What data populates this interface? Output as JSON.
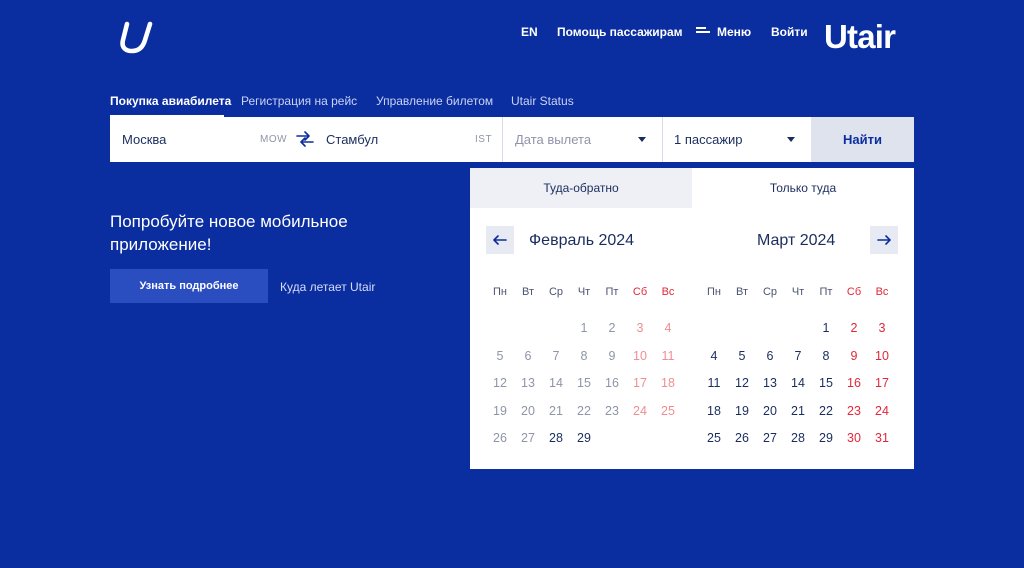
{
  "brand": "Utair",
  "topnav": {
    "lang": "EN",
    "help": "Помощь пассажирам",
    "menu": "Меню",
    "login": "Войти"
  },
  "tabs": [
    "Покупка авиабилета",
    "Регистрация на рейс",
    "Управление билетом",
    "Utair Status"
  ],
  "search": {
    "from_city": "Москва",
    "from_code": "MOW",
    "to_city": "Стамбул",
    "to_code": "IST",
    "date_placeholder": "Дата вылета",
    "passengers": "1 пассажир",
    "find": "Найти"
  },
  "promo": {
    "title": "Попробуйте новое мобильное приложение!",
    "button": "Узнать подробнее",
    "link": "Куда летает Utair"
  },
  "calendar": {
    "tabs": [
      "Туда-обратно",
      "Только туда"
    ],
    "weekdays": [
      "Пн",
      "Вт",
      "Ср",
      "Чт",
      "Пт",
      "Сб",
      "Вс"
    ],
    "months": [
      {
        "title": "Февраль 2024",
        "first_weekday": 3,
        "days": 29,
        "first_available": 28
      },
      {
        "title": "Март 2024",
        "first_weekday": 4,
        "days": 31,
        "first_available": 1
      }
    ]
  },
  "colors": {
    "background": "#0a2da0",
    "accent": "#0a2da0",
    "weekend": "#e0283a",
    "text": "#1b2d5e"
  }
}
